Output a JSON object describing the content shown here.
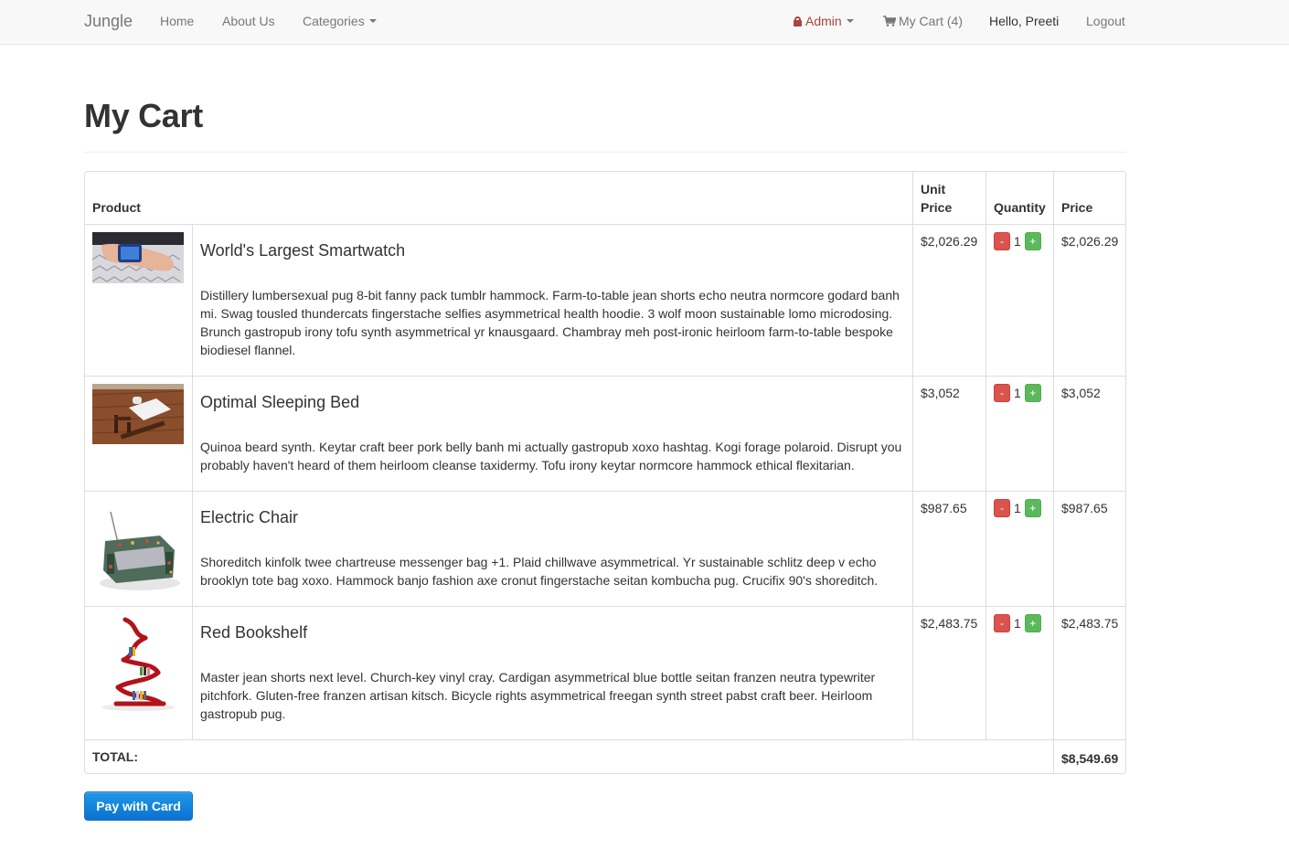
{
  "navbar": {
    "brand": "Jungle",
    "links": [
      "Home",
      "About Us",
      "Categories"
    ],
    "admin_label": "Admin",
    "cart_label": "My Cart (4)",
    "greeting": "Hello, Preeti",
    "logout_label": "Logout"
  },
  "page": {
    "title": "My Cart"
  },
  "table": {
    "headers": {
      "product": "Product",
      "unit_price_line1": "Unit",
      "unit_price_line2": "Price",
      "quantity": "Quantity",
      "price": "Price"
    },
    "items": [
      {
        "name": "World's Largest Smartwatch",
        "description": "Distillery lumbersexual pug 8-bit fanny pack tumblr hammock. Farm-to-table jean shorts echo neutra normcore godard banh mi. Swag tousled thundercats fingerstache selfies asymmetrical health hoodie. 3 wolf moon sustainable lomo microdosing. Brunch gastropub irony tofu synth asymmetrical yr knausgaard. Chambray meh post-ironic heirloom farm-to-table bespoke biodiesel flannel.",
        "unit_price": "$2,026.29",
        "quantity": "1",
        "price": "$2,026.29"
      },
      {
        "name": "Optimal Sleeping Bed",
        "description": "Quinoa beard synth. Keytar craft beer pork belly banh mi actually gastropub xoxo hashtag. Kogi forage polaroid. Disrupt you probably haven't heard of them heirloom cleanse taxidermy. Tofu irony keytar normcore hammock ethical flexitarian.",
        "unit_price": "$3,052",
        "quantity": "1",
        "price": "$3,052"
      },
      {
        "name": "Electric Chair",
        "description": "Shoreditch kinfolk twee chartreuse messenger bag +1. Plaid chillwave asymmetrical. Yr sustainable schlitz deep v echo brooklyn tote bag xoxo. Hammock banjo fashion axe cronut fingerstache seitan kombucha pug. Crucifix 90's shoreditch.",
        "unit_price": "$987.65",
        "quantity": "1",
        "price": "$987.65"
      },
      {
        "name": "Red Bookshelf",
        "description": "Master jean shorts next level. Church-key vinyl cray. Cardigan asymmetrical blue bottle seitan franzen neutra typewriter pitchfork. Gluten-free franzen artisan kitsch. Bicycle rights asymmetrical freegan synth street pabst craft beer. Heirloom gastropub pug.",
        "unit_price": "$2,483.75",
        "quantity": "1",
        "price": "$2,483.75"
      }
    ],
    "minus_label": "-",
    "plus_label": "+",
    "total_label": "TOTAL:",
    "total_value": "$8,549.69"
  },
  "pay_button_label": "Pay with Card",
  "colors": {
    "danger": "#d9534f",
    "success": "#5cb85c",
    "primary": "#0c71d0",
    "admin": "#a94442"
  }
}
